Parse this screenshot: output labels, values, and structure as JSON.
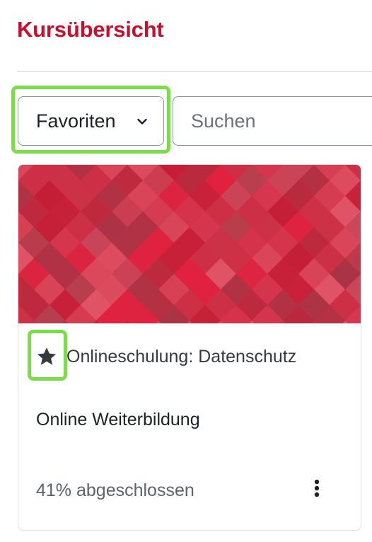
{
  "header": {
    "title": "Kursübersicht"
  },
  "controls": {
    "filter_label": "Favoriten",
    "search_placeholder": "Suchen"
  },
  "course": {
    "name": "Onlineschulung: Datenschutz",
    "category": "Online Weiterbildung",
    "progress_text": "41% abgeschlossen",
    "progress_percent": 41,
    "is_starred": true
  },
  "icons": {
    "filter_dropdown": "chevron-down-icon",
    "favorite": "star-icon",
    "actions": "more-vertical-icon"
  },
  "colors": {
    "title": "#c8102e",
    "highlight": "#7ddc4a",
    "pattern_base": "#d31f3a"
  }
}
